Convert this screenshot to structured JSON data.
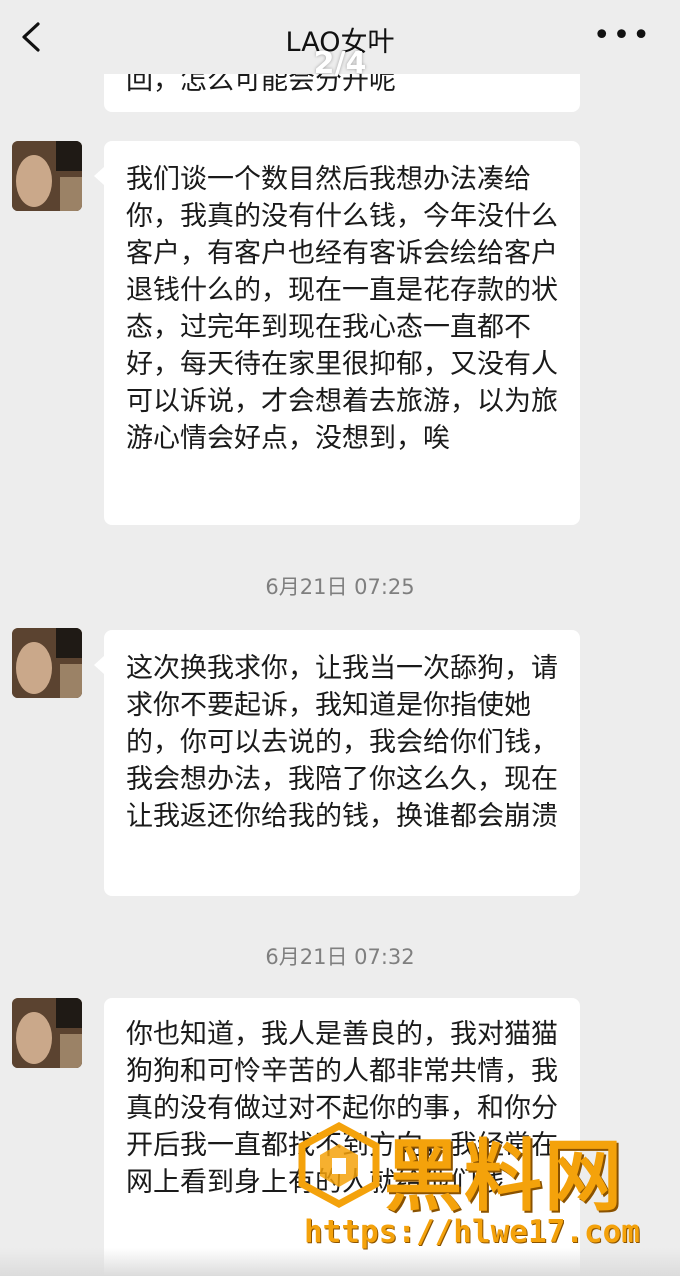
{
  "header": {
    "title": "LAO女叶",
    "counter": "2/4",
    "more_label": "•••"
  },
  "messages": [
    {
      "text": "回，怎么可能会分开呢"
    },
    {
      "text": "我们谈一个数目然后我想办法凑给你，我真的没有什么钱，今年没什么客户，有客户也经有客诉会绘给客户退钱什么的，现在一直是花存款的状态，过完年到现在我心态一直都不好，每天待在家里很抑郁，又没有人可以诉说，才会想着去旅游，以为旅游心情会好点，没想到，唉"
    },
    {
      "text": "这次换我求你，让我当一次舔狗，请求你不要起诉，我知道是你指使她的，你可以去说的，我会给你们钱，我会想办法，我陪了你这么久，现在让我返还你给我的钱，换谁都会崩溃"
    },
    {
      "text": "你也知道，我人是善良的，我对猫猫狗狗和可怜辛苦的人都非常共情，我真的没有做过对不起你的事，和你分开后我一直都找不到方向，我经常在网上看到身上有的人就给他们钱"
    }
  ],
  "timestamps": {
    "t1": "6月21日 07:25",
    "t2": "6月21日 07:32"
  },
  "watermark": {
    "brand": "黑料网",
    "url": "https://hlwe17.com"
  }
}
